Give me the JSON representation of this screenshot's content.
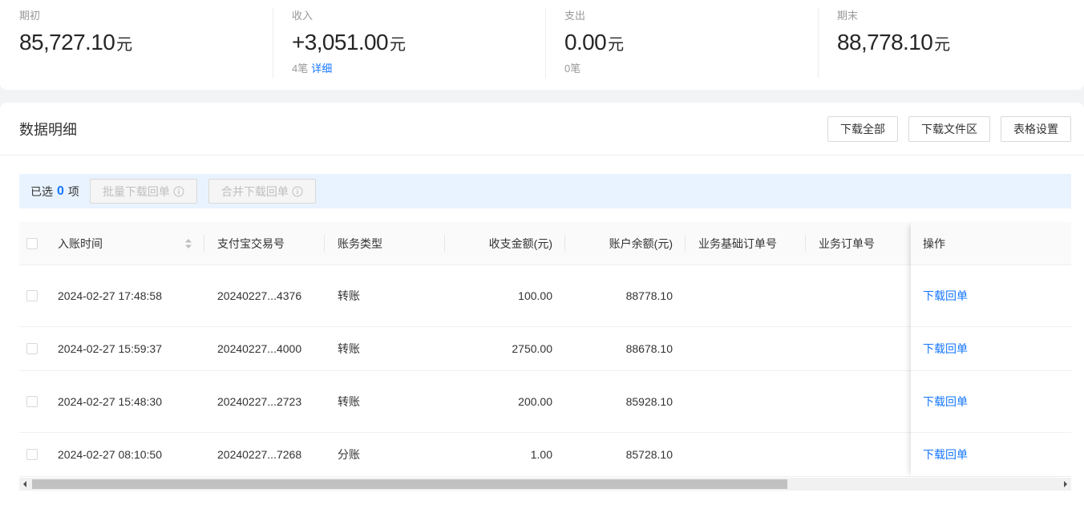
{
  "colors": {
    "accent": "#1677ff",
    "page_background": "#f2f3f5",
    "selection_bar_background": "#e9f3ff"
  },
  "summary": [
    {
      "label": "期初",
      "amount": "85,727.10",
      "unit": "元"
    },
    {
      "label": "收入",
      "amount": "+3,051.00",
      "unit": "元",
      "count": "4笔",
      "link": "详细"
    },
    {
      "label": "支出",
      "amount": "0.00",
      "unit": "元",
      "count": "0笔"
    },
    {
      "label": "期末",
      "amount": "88,778.10",
      "unit": "元"
    }
  ],
  "details": {
    "title": "数据明细",
    "buttons": {
      "download_all": "下载全部",
      "download_area": "下载文件区",
      "table_settings": "表格设置"
    }
  },
  "selection": {
    "prefix": "已选",
    "count": "0",
    "suffix": "项",
    "batch_download": "批量下载回单",
    "merge_download": "合并下载回单",
    "buttons_disabled": true,
    "icon": "info-circle-icon"
  },
  "table": {
    "select_all_checked": false,
    "sort_icon": "sort-icon",
    "columns": {
      "time": "入账时间",
      "trade_no": "支付宝交易号",
      "type": "账务类型",
      "amount": "收支金额(元)",
      "balance": "账户余额(元)",
      "biz_base_order_no": "业务基础订单号",
      "biz_order_no": "业务订单号",
      "action": "操作"
    },
    "rows": [
      {
        "checked": false,
        "time": "2024-02-27 17:48:58",
        "trade_no": "20240227...4376",
        "type": "转账",
        "amount": "100.00",
        "balance": "88778.10",
        "action": "下载回单"
      },
      {
        "checked": false,
        "time": "2024-02-27 15:59:37",
        "trade_no": "20240227...4000",
        "type": "转账",
        "amount": "2750.00",
        "balance": "88678.10",
        "action": "下载回单"
      },
      {
        "checked": false,
        "time": "2024-02-27 15:48:30",
        "trade_no": "20240227...2723",
        "type": "转账",
        "amount": "200.00",
        "balance": "85928.10",
        "action": "下载回单"
      },
      {
        "checked": false,
        "time": "2024-02-27 08:10:50",
        "trade_no": "20240227...7268",
        "type": "分账",
        "amount": "1.00",
        "balance": "85728.10",
        "action": "下载回单"
      }
    ]
  }
}
